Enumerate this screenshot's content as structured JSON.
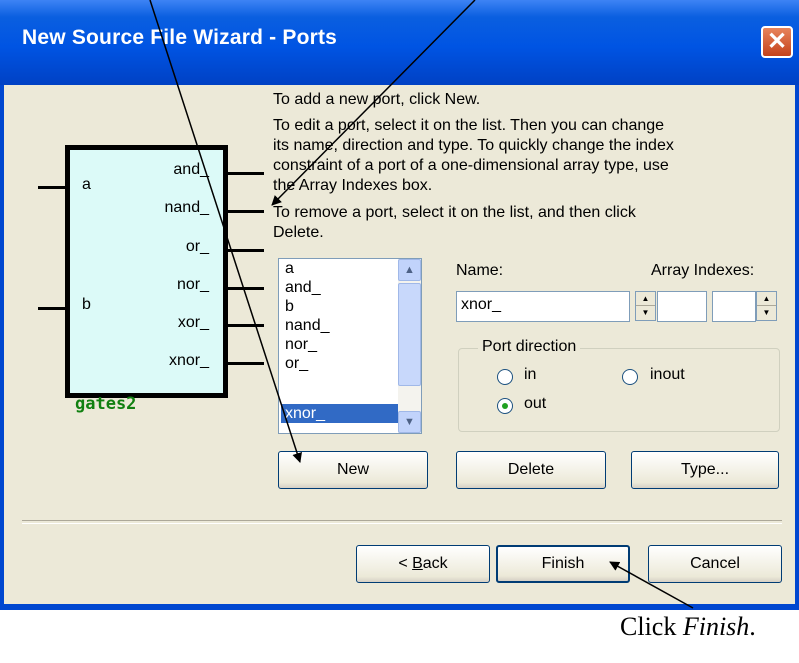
{
  "window": {
    "title": "New Source File Wizard - Ports",
    "close_label": "✕"
  },
  "instructions": {
    "line1": "To add a new port, click New.",
    "line2": "To edit a port, select it on the list. Then you can change",
    "line3": "its name, direction and type. To quickly change the index",
    "line4": "constraint of a port of a one-dimensional array type, use",
    "line5": "the Array Indexes box.",
    "line6": "To remove a port, select it on the list, and then click",
    "line7": "Delete."
  },
  "symbol": {
    "name": "gates2",
    "inputs": [
      "a",
      "b"
    ],
    "outputs": [
      "and_",
      "nand_",
      "or_",
      "nor_",
      "xor_",
      "xnor_"
    ]
  },
  "port_list": {
    "items": [
      "a",
      "and_",
      "b",
      "nand_",
      "nor_",
      "or_",
      "xnor_"
    ],
    "selected": "xnor_"
  },
  "name_field": {
    "label": "Name:",
    "value": "xnor_"
  },
  "array_indexes": {
    "label": "Array Indexes:",
    "from": "",
    "to": ""
  },
  "port_direction": {
    "title": "Port direction",
    "options": {
      "in": "in",
      "inout": "inout",
      "out": "out"
    },
    "selected": "out"
  },
  "buttons": {
    "new": "New",
    "delete": "Delete",
    "type": "Type...",
    "back_prefix": "< ",
    "back_key": "B",
    "back_rest": "ack",
    "finish": "Finish",
    "cancel": "Cancel"
  },
  "caption": {
    "text": "Click ",
    "emphasis": "Finish",
    "end": "."
  }
}
